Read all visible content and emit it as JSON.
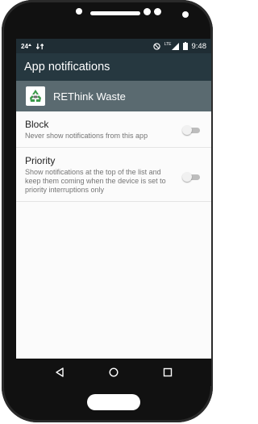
{
  "status_bar": {
    "left_text": "24",
    "left_icons": [
      "notification-number-icon",
      "sync-arrows-icon"
    ],
    "right_icons": [
      "do-not-disturb-icon",
      "lte-signal-icon",
      "battery-icon"
    ],
    "network_label": "LTE",
    "time": "9:48"
  },
  "app_bar": {
    "title": "App notifications"
  },
  "app_header": {
    "icon": "recycle-logo-icon",
    "name": "REThink Waste"
  },
  "settings": [
    {
      "title": "Block",
      "description": "Never show notifications from this app",
      "enabled": false
    },
    {
      "title": "Priority",
      "description": "Show notifications at the top of the list and keep them coming when the device is set to priority interruptions only",
      "enabled": false
    }
  ],
  "nav_bar": {
    "buttons": [
      "back-icon",
      "home-icon",
      "recents-icon"
    ]
  },
  "colors": {
    "status_bar": "#1f2d34",
    "app_bar": "#263840",
    "app_header": "#5a6a70",
    "screen_background": "#fbfbfb",
    "phone_body": "#111111",
    "recycle_green": "#3b9a4a"
  }
}
